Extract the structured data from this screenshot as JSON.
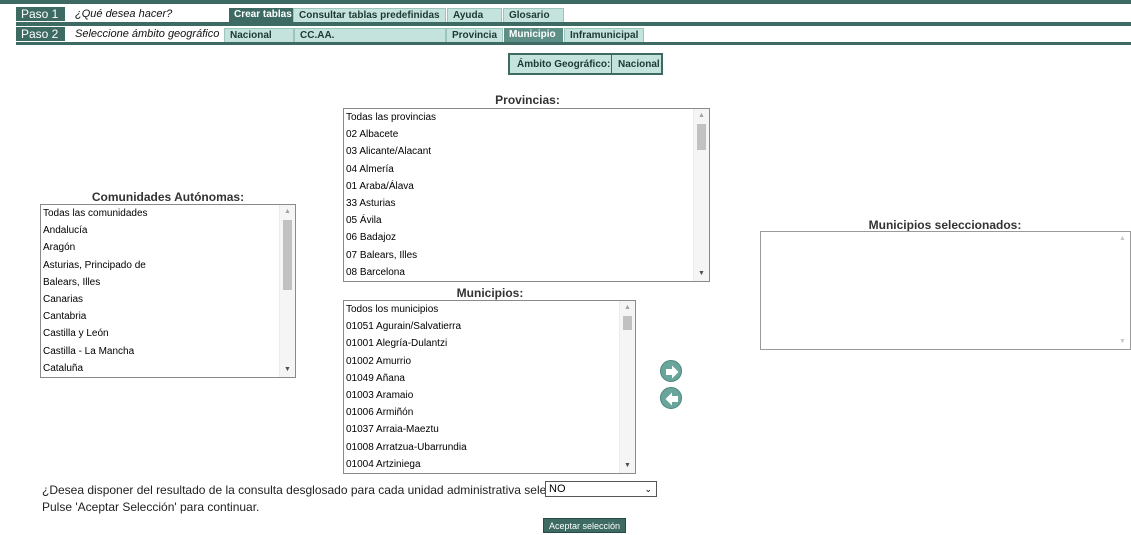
{
  "step1": {
    "label": "Paso 1",
    "question": "¿Qué desea hacer?"
  },
  "step2": {
    "label": "Paso 2",
    "question": "Seleccione ámbito geográfico"
  },
  "step1_tabs": [
    "Crear tablas",
    "Consultar tablas predefinidas",
    "Ayuda",
    "Glosario"
  ],
  "step2_tabs": [
    "Nacional",
    "CC.AA.",
    "Provincia",
    "Municipio",
    "Inframunicipal"
  ],
  "ambito": {
    "label": "Ámbito Geográfico:",
    "value": "Nacional"
  },
  "ccaa": {
    "heading": "Comunidades Autónomas:",
    "items": [
      "Todas las comunidades",
      "Andalucía",
      "Aragón",
      "Asturias, Principado de",
      "Balears, Illes",
      "Canarias",
      "Cantabria",
      "Castilla y León",
      "Castilla - La Mancha",
      "Cataluña"
    ]
  },
  "provincias": {
    "heading": "Provincias:",
    "items": [
      "Todas las provincias",
      "02 Albacete",
      "03 Alicante/Alacant",
      "04 Almería",
      "01 Araba/Álava",
      "33 Asturias",
      "05 Ávila",
      "06 Badajoz",
      "07 Balears, Illes",
      "08 Barcelona"
    ]
  },
  "municipios": {
    "heading": "Municipios:",
    "items": [
      "Todos los municipios",
      "01051 Agurain/Salvatierra",
      "01001 Alegría-Dulantzi",
      "01002 Amurrio",
      "01049 Añana",
      "01003 Aramaio",
      "01006 Armiñón",
      "01037 Arraia-Maeztu",
      "01008 Arratzua-Ubarrundia",
      "01004 Artziniega"
    ]
  },
  "seleccionados": {
    "heading": "Municipios seleccionados:"
  },
  "desglose": {
    "question": "¿Desea disponer del resultado de la consulta desglosado para cada unidad administrativa seleccionada?",
    "selected": "NO"
  },
  "hint": "Pulse 'Aceptar Selección' para continuar.",
  "accept_label": "Aceptar selección",
  "icons": {
    "add": "arrow-right-icon",
    "remove": "arrow-left-icon"
  },
  "colors": {
    "primary": "#3d6b63",
    "tab_light": "#c5e3dd",
    "button": "#6aa59c"
  }
}
